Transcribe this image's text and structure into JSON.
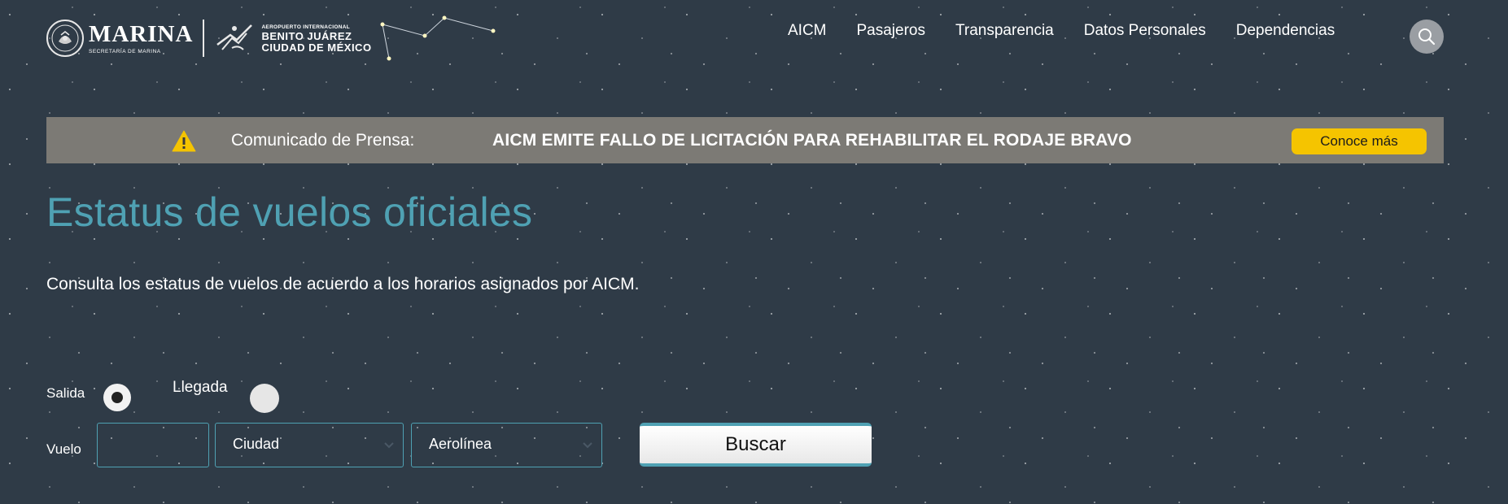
{
  "header": {
    "marina_logo": {
      "title": "MARINA",
      "subtitle": "SECRETARÍA DE MARINA",
      "icon": "national-seal-icon"
    },
    "aicm_logo": {
      "line1": "AEROPUERTO INTERNACIONAL",
      "line2": "BENITO JUÁREZ",
      "line3": "CIUDAD DE MÉXICO",
      "icon": "plane-logo-icon"
    },
    "nav": [
      "AICM",
      "Pasajeros",
      "Transparencia",
      "Datos Personales",
      "Dependencias"
    ],
    "search_icon": "search-icon"
  },
  "press": {
    "icon": "warning-icon",
    "label": "Comunicado de Prensa:",
    "title": "AICM EMITE FALLO DE LICITACIÓN PARA REHABILITAR EL RODAJE BRAVO",
    "button": "Conoce más"
  },
  "main": {
    "title": "Estatus de vuelos oficiales",
    "description": "Consulta los estatus de vuelos de acuerdo a los horarios asignados por AICM."
  },
  "form": {
    "salida_label": "Salida",
    "llegada_label": "Llegada",
    "selected": "Salida",
    "vuelo_label": "Vuelo",
    "vuelo_value": "",
    "ciudad_value": "Ciudad",
    "aerolinea_value": "Aerolínea",
    "search_button": "Buscar"
  },
  "colors": {
    "background": "#2f3b47",
    "accent": "#4fa1b3",
    "press_bar": "#7c7a75",
    "press_button": "#f5c400"
  }
}
